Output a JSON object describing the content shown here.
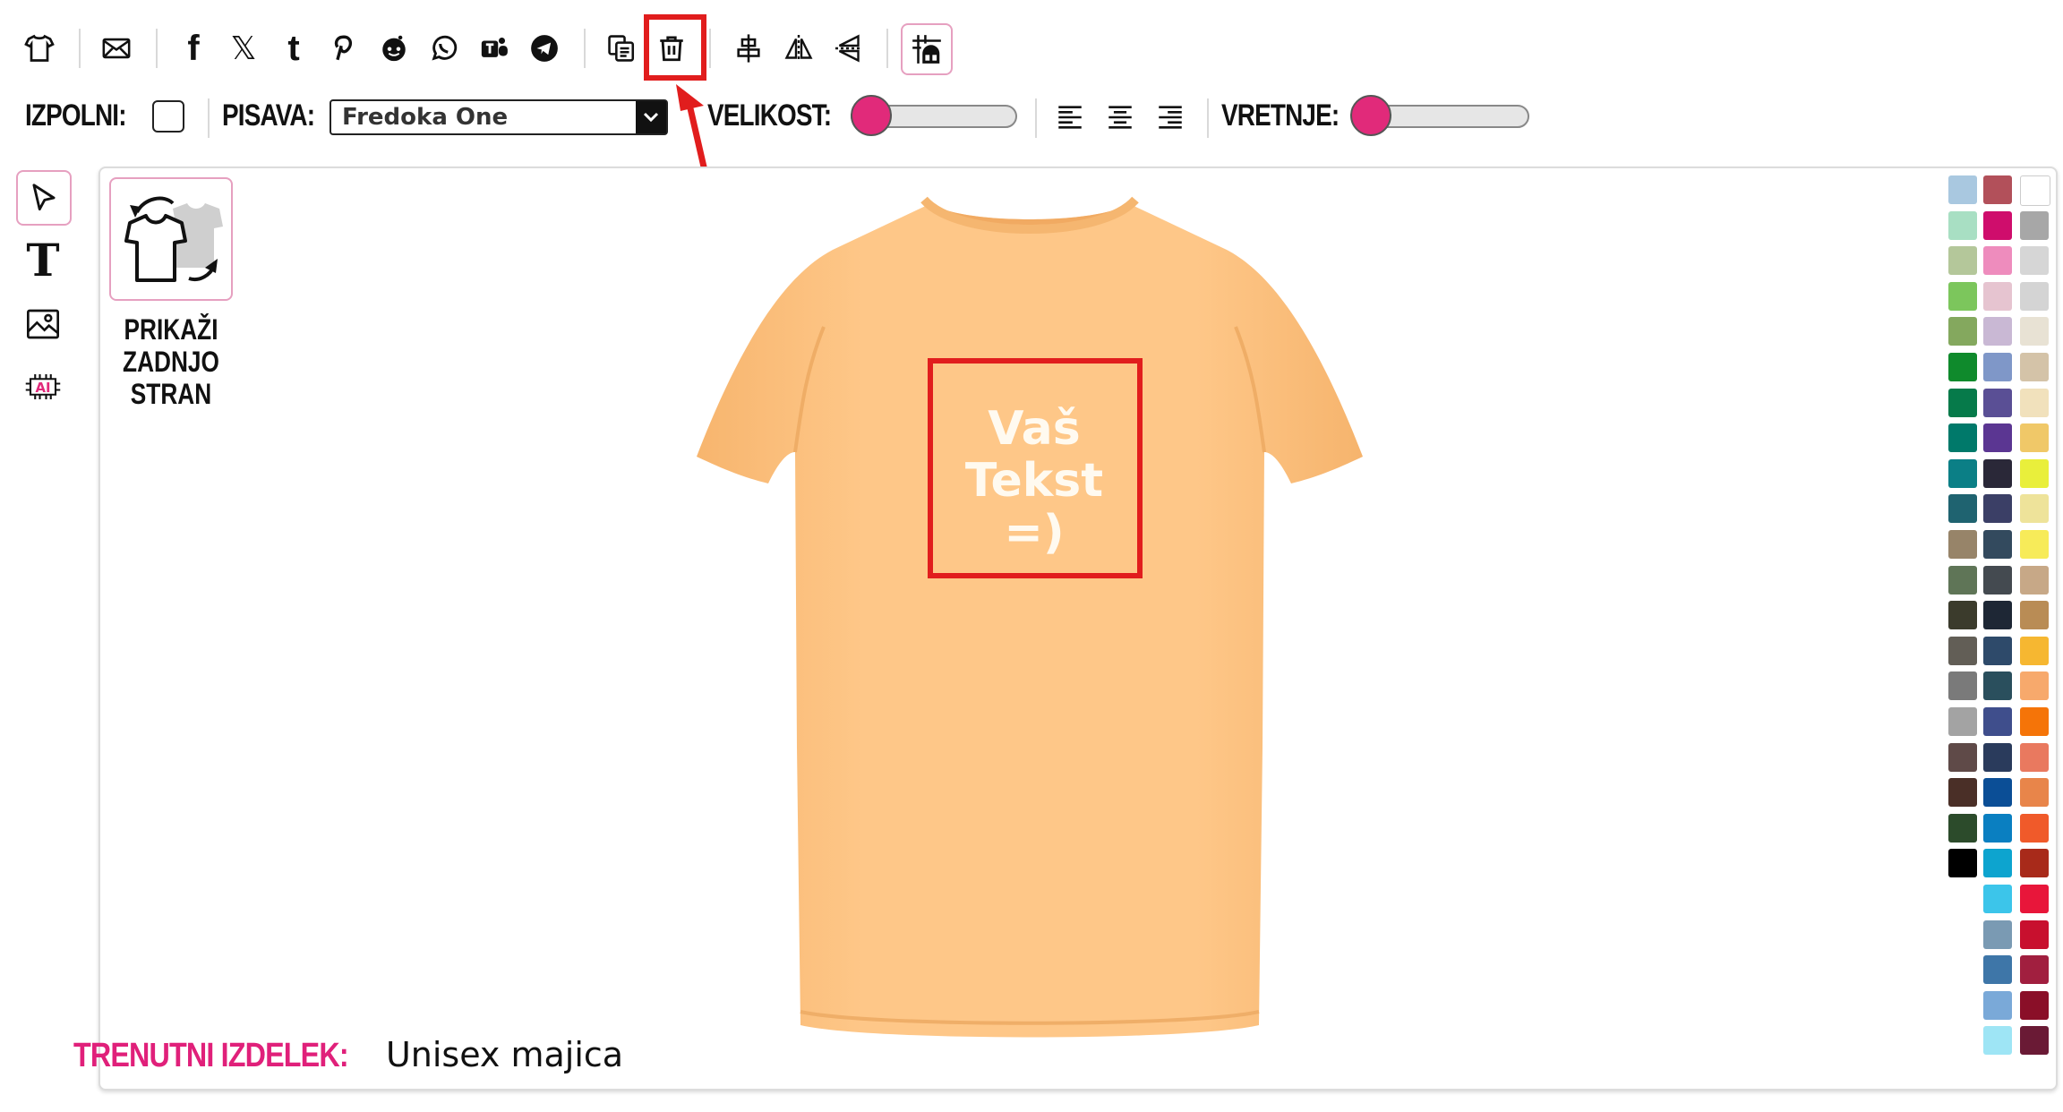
{
  "toolbar": {
    "icons": [
      "tshirt-icon",
      "mail-icon",
      "facebook-icon",
      "x-icon",
      "tumblr-icon",
      "pinterest-icon",
      "reddit-icon",
      "whatsapp-icon",
      "teams-icon",
      "telegram-icon",
      "copy-icon",
      "trash-icon",
      "align-center-vertical-icon",
      "flip-horizontal-icon",
      "flip-vertical-icon",
      "grid-icon"
    ]
  },
  "props": {
    "fill_label": "IZPOLNI:",
    "font_label": "PISAVA:",
    "font_value": "Fredoka One",
    "size_label": "VELIKOST:",
    "size_value": 0,
    "spacing_label": "VRETNJE:",
    "spacing_value": 0
  },
  "left_tools": [
    "select-pointer-icon",
    "text-tool-icon",
    "image-tool-icon",
    "ai-tool-icon"
  ],
  "back_button": {
    "label": "PRIKAŽI ZADNJO STRAN"
  },
  "design": {
    "line1": "Vaš",
    "line2": "Tekst",
    "line3": "=)"
  },
  "product": {
    "key": "TRENUTNI IZDELEK:",
    "value": "Unisex majica"
  },
  "colors": {
    "accent": "#e12a7a",
    "highlight": "#e11d1d",
    "shirt": "#fec788",
    "palette_col1": [
      "#a9c8e0",
      "#a8dfc3",
      "#b4c79a",
      "#7cc65c",
      "#84a85e",
      "#0f8a2c",
      "#067a4a",
      "#00796a",
      "#0b7f86",
      "#1f6370",
      "#978469",
      "#5f7557",
      "#3b3b2c",
      "#625e56",
      "#7a7a7a",
      "#a3a3a3",
      "#5f4a48",
      "#4a2f27",
      "#2c4b2b",
      "#000000"
    ],
    "palette_col2": [
      "#b2505a",
      "#cf0d6c",
      "#ee8cbd",
      "#e6c4d0",
      "#c9b8d4",
      "#7f97c8",
      "#5a4f95",
      "#5b3692",
      "#2a2838",
      "#3b3f66",
      "#334a5e",
      "#444a50",
      "#1e2735",
      "#2e4a6a",
      "#2a4f5d",
      "#3f4e8c",
      "#2a3b5c",
      "#0b4e96",
      "#0a7fc1",
      "#0da4cf",
      "#3cc5ea",
      "#7a9ab3",
      "#3e76a8",
      "#7aa9d8",
      "#9ee5f5"
    ],
    "palette_col3": [
      "#ffffff",
      "#a7a7a7",
      "#d6d6d6",
      "#d4d4d4",
      "#e8e2d4",
      "#d4c3a8",
      "#f1e1bc",
      "#f0c868",
      "#e9ef3b",
      "#eee39a",
      "#f7eb59",
      "#c7a887",
      "#b98c55",
      "#f6b731",
      "#f7a96c",
      "#f57408",
      "#e9795f",
      "#e8854a",
      "#f05a2a",
      "#a82a1a",
      "#e8163a",
      "#c8102e",
      "#a11f3f",
      "#8a0f28",
      "#6a1a35"
    ]
  }
}
